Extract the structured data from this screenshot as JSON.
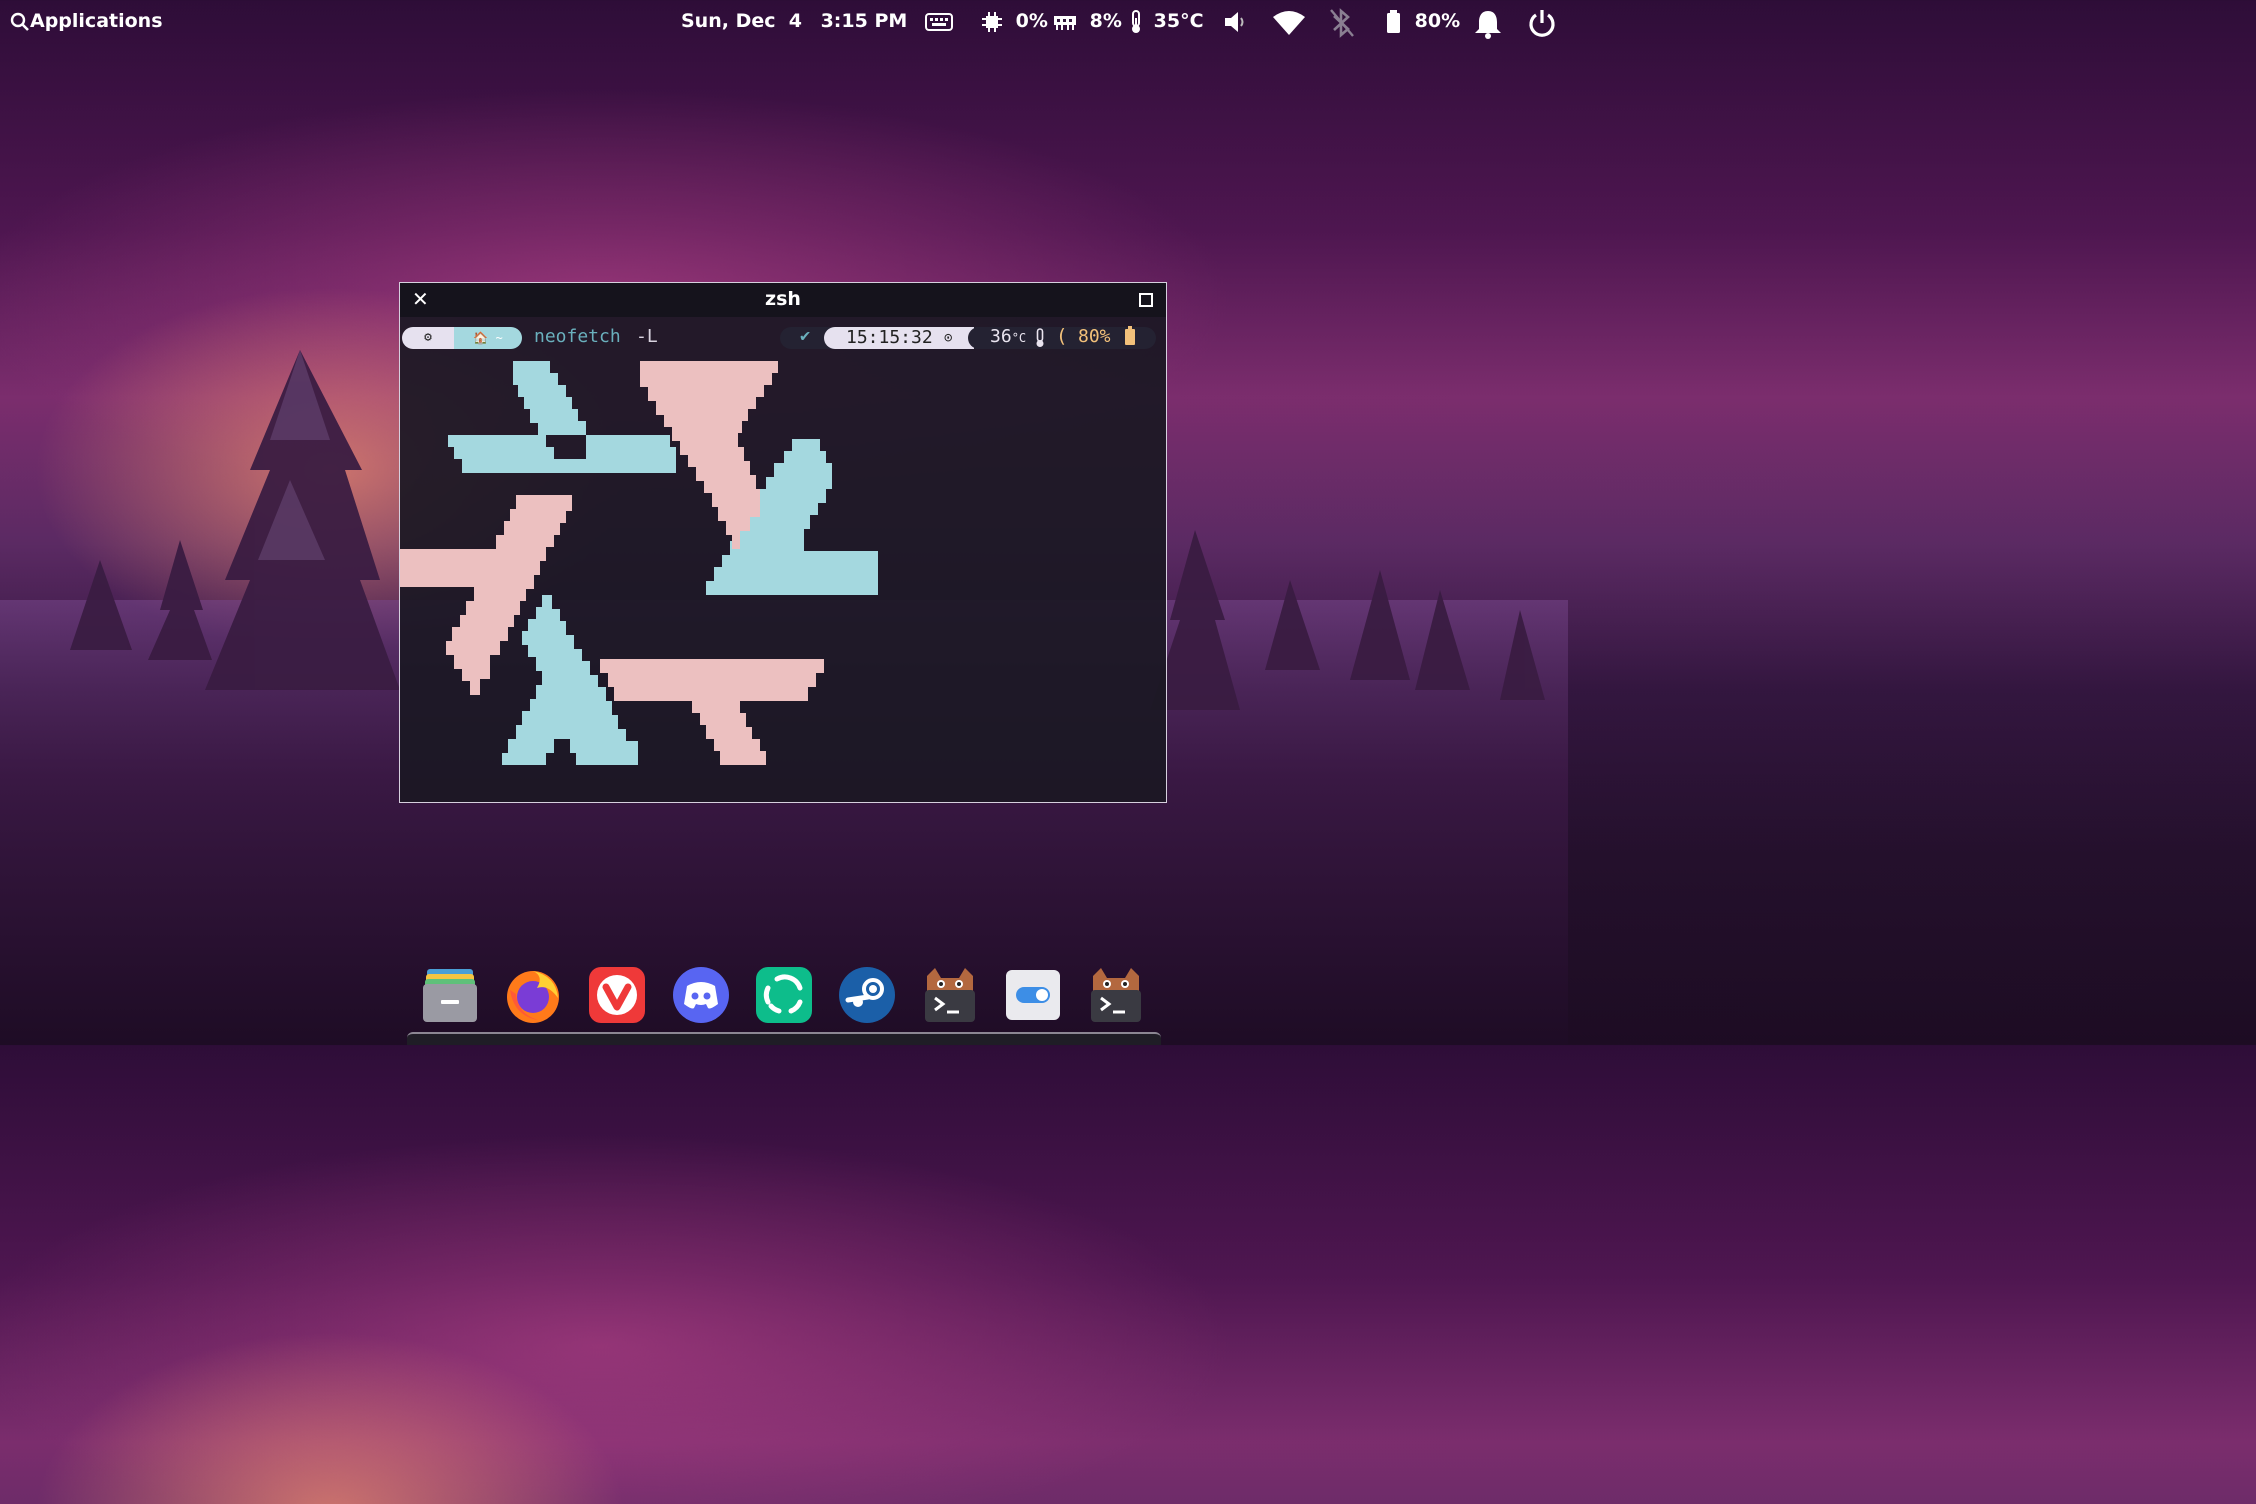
{
  "panel": {
    "applications_label": "Applications",
    "date_label": "Sun, Dec  4",
    "time_label": "3:15 PM",
    "cpu_label": "0%",
    "memory_label": "8%",
    "temperature_label": "35°C",
    "battery_label": "80%"
  },
  "terminal": {
    "title": "zsh",
    "close_glyph": "✕",
    "gear_glyph": "⚙",
    "home_glyph": "🏠 ~",
    "command": "neofetch",
    "command_arg": "-L",
    "check_glyph": "✔",
    "clock": "15:15:32",
    "clock_glyph": "⊙",
    "temperature": "36",
    "temperature_unit": "°C",
    "moon_glyph": "(",
    "battery": "80%"
  },
  "logo_colors": {
    "cyan": "#a4d8df",
    "pink": "#ecc0c0"
  },
  "dock": {
    "items": [
      {
        "icon": "files-icon"
      },
      {
        "icon": "firefox-icon"
      },
      {
        "icon": "vivaldi-icon"
      },
      {
        "icon": "discord-icon"
      },
      {
        "icon": "element-icon"
      },
      {
        "icon": "steam-icon"
      },
      {
        "icon": "terminal-cat-icon"
      },
      {
        "icon": "toggle-settings-icon"
      },
      {
        "icon": "terminal-cat-icon"
      }
    ]
  }
}
